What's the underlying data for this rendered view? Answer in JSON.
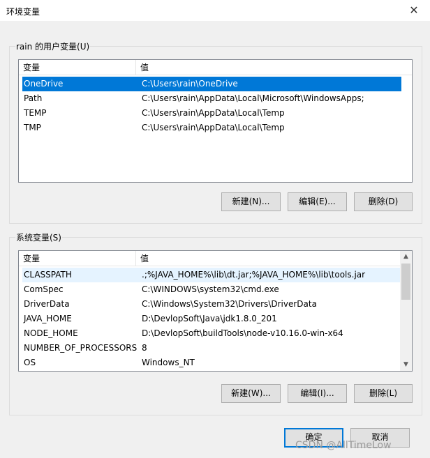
{
  "window": {
    "title": "环境变量",
    "close_glyph": "✕"
  },
  "user_vars": {
    "legend": "rain 的用户变量(U)",
    "columns": [
      "变量",
      "值"
    ],
    "rows": [
      {
        "name": "OneDrive",
        "value": "C:\\Users\\rain\\OneDrive",
        "selected": true
      },
      {
        "name": "Path",
        "value": "C:\\Users\\rain\\AppData\\Local\\Microsoft\\WindowsApps;"
      },
      {
        "name": "TEMP",
        "value": "C:\\Users\\rain\\AppData\\Local\\Temp"
      },
      {
        "name": "TMP",
        "value": "C:\\Users\\rain\\AppData\\Local\\Temp"
      }
    ],
    "buttons": {
      "new": "新建(N)...",
      "edit": "编辑(E)...",
      "delete": "删除(D)"
    }
  },
  "system_vars": {
    "legend": "系统变量(S)",
    "columns": [
      "变量",
      "值"
    ],
    "rows": [
      {
        "name": "CLASSPATH",
        "value": ".;%JAVA_HOME%\\lib\\dt.jar;%JAVA_HOME%\\lib\\tools.jar",
        "hover": true
      },
      {
        "name": "ComSpec",
        "value": "C:\\WINDOWS\\system32\\cmd.exe"
      },
      {
        "name": "DriverData",
        "value": "C:\\Windows\\System32\\Drivers\\DriverData"
      },
      {
        "name": "JAVA_HOME",
        "value": "D:\\DevlopSoft\\Java\\jdk1.8.0_201"
      },
      {
        "name": "NODE_HOME",
        "value": "D:\\DevlopSoft\\buildTools\\node-v10.16.0-win-x64"
      },
      {
        "name": "NUMBER_OF_PROCESSORS",
        "value": "8"
      },
      {
        "name": "OS",
        "value": "Windows_NT"
      }
    ],
    "buttons": {
      "new": "新建(W)...",
      "edit": "编辑(I)...",
      "delete": "删除(L)"
    }
  },
  "footer": {
    "ok": "确定",
    "cancel": "取消"
  },
  "watermark": "CSDN @AllTimeLow",
  "colors": {
    "selection": "#0078d7",
    "hover": "#e5f3ff",
    "default_button_border": "#0078d7"
  }
}
